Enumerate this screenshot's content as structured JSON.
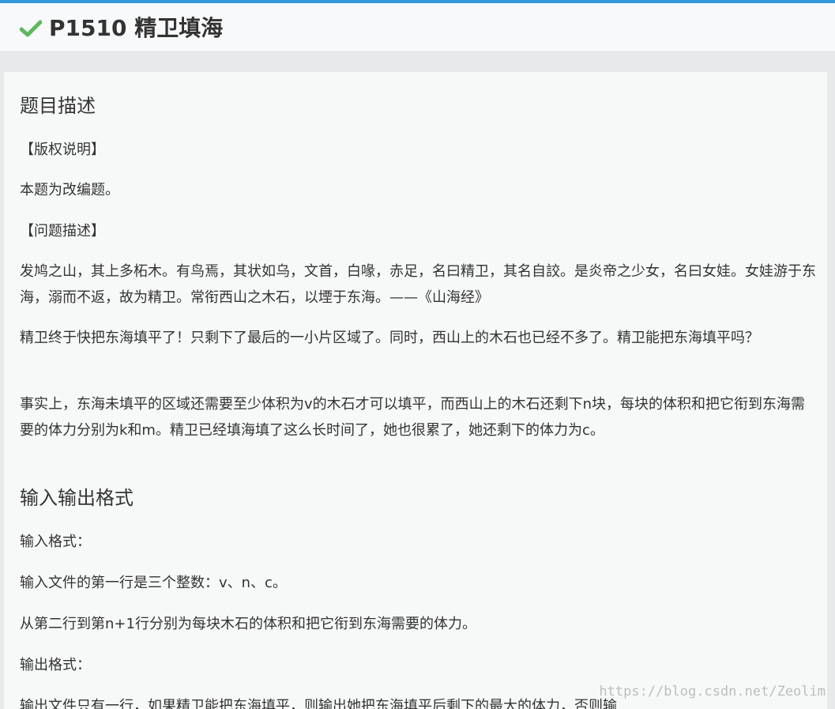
{
  "colors": {
    "accent": "#3498db",
    "check": "#5cb85c",
    "text": "#333333",
    "card_bg": "#f7f8f8",
    "page_bg": "#e8e9ea"
  },
  "header": {
    "icon": "check-icon",
    "title": "P1510 精卫填海"
  },
  "description": {
    "heading": "题目描述",
    "paragraphs": [
      "【版权说明】",
      "本题为改编题。",
      "【问题描述】",
      "发鸠之山，其上多柘木。有鸟焉，其状如乌，文首，白喙，赤足，名曰精卫，其名自詨。是炎帝之少女，名曰女娃。女娃游于东海，溺而不返，故为精卫。常衔西山之木石，以堙于东海。——《山海经》",
      "精卫终于快把东海填平了！只剩下了最后的一小片区域了。同时，西山上的木石也已经不多了。精卫能把东海填平吗？",
      "事实上，东海未填平的区域还需要至少体积为v的木石才可以填平，而西山上的木石还剩下n块，每块的体积和把它衔到东海需要的体力分别为k和m。精卫已经填海填了这么长时间了，她也很累了，她还剩下的体力为c。"
    ]
  },
  "io_format": {
    "heading": "输入输出格式",
    "paragraphs": [
      "输入格式：",
      "输入文件的第一行是三个整数：v、n、c。",
      "从第二行到第n+1行分别为每块木石的体积和把它衔到东海需要的体力。",
      "输出格式：",
      "输出文件只有一行，如果精卫能把东海填平，则输出她把东海填平后剩下的最大的体力，否则输"
    ]
  },
  "watermark": "https://blog.csdn.net/Zeolim"
}
